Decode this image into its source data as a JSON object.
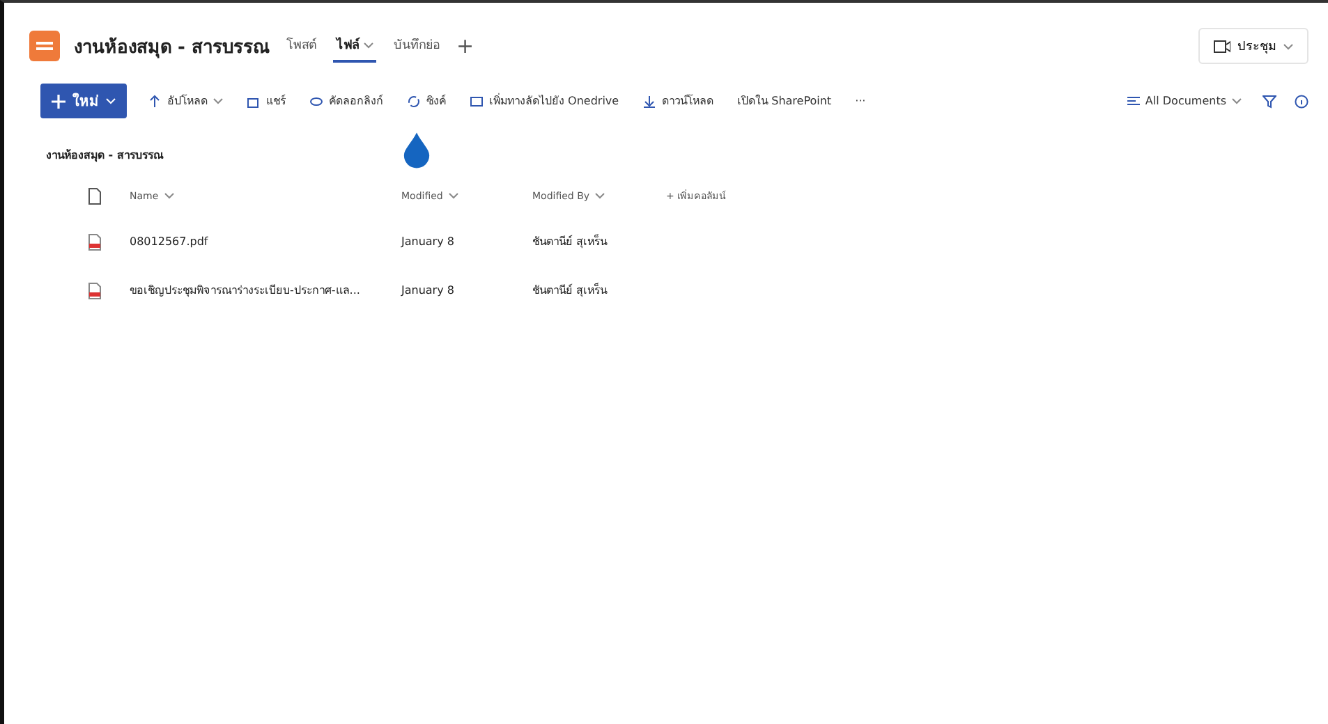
{
  "header": {
    "title": "งานห้องสมุด - สารบรรณ",
    "tabs": [
      {
        "label": "โพสต์",
        "selected": false,
        "dropdown": false
      },
      {
        "label": "ไฟล์",
        "selected": true,
        "dropdown": true
      },
      {
        "label": "บันทึกย่อ",
        "selected": false,
        "dropdown": false
      }
    ],
    "add_tab": "+",
    "meeting": "ประชุม"
  },
  "toolbar": {
    "new": "ใหม่",
    "actions": [
      {
        "kind": "upload",
        "label": "อัปโหลด",
        "dropdown": true
      },
      {
        "kind": "share",
        "label": "แชร์",
        "dropdown": false
      },
      {
        "kind": "link",
        "label": "คัดลอกลิงก์",
        "dropdown": false
      },
      {
        "kind": "sync",
        "label": "ซิงค์",
        "dropdown": false
      },
      {
        "kind": "shortcut",
        "label": "เพิ่มทางลัดไปยัง Onedrive",
        "dropdown": false
      },
      {
        "kind": "download",
        "label": "ดาวน์โหลด",
        "dropdown": false
      },
      {
        "kind": "plain",
        "label": "เปิดใน SharePoint",
        "dropdown": false
      },
      {
        "kind": "plain",
        "label": "···",
        "dropdown": false
      }
    ],
    "view": "All Documents"
  },
  "breadcrumb": "งานห้องสมุด - สารบรรณ",
  "table": {
    "columns": [
      "Name",
      "Modified",
      "Modified By"
    ],
    "add_column": "+ เพิ่มคอลัมน์",
    "rows": [
      {
        "name": "08012567.pdf",
        "modified": "January 8",
        "modified_by": "ชันตานีย์ สุเหร็น"
      },
      {
        "name": "ขอเชิญประชุมพิจารณาร่างระเบียบ-ประกาศ-แล...",
        "modified": "January 8",
        "modified_by": "ชันตานีย์ สุเหร็น"
      }
    ]
  }
}
